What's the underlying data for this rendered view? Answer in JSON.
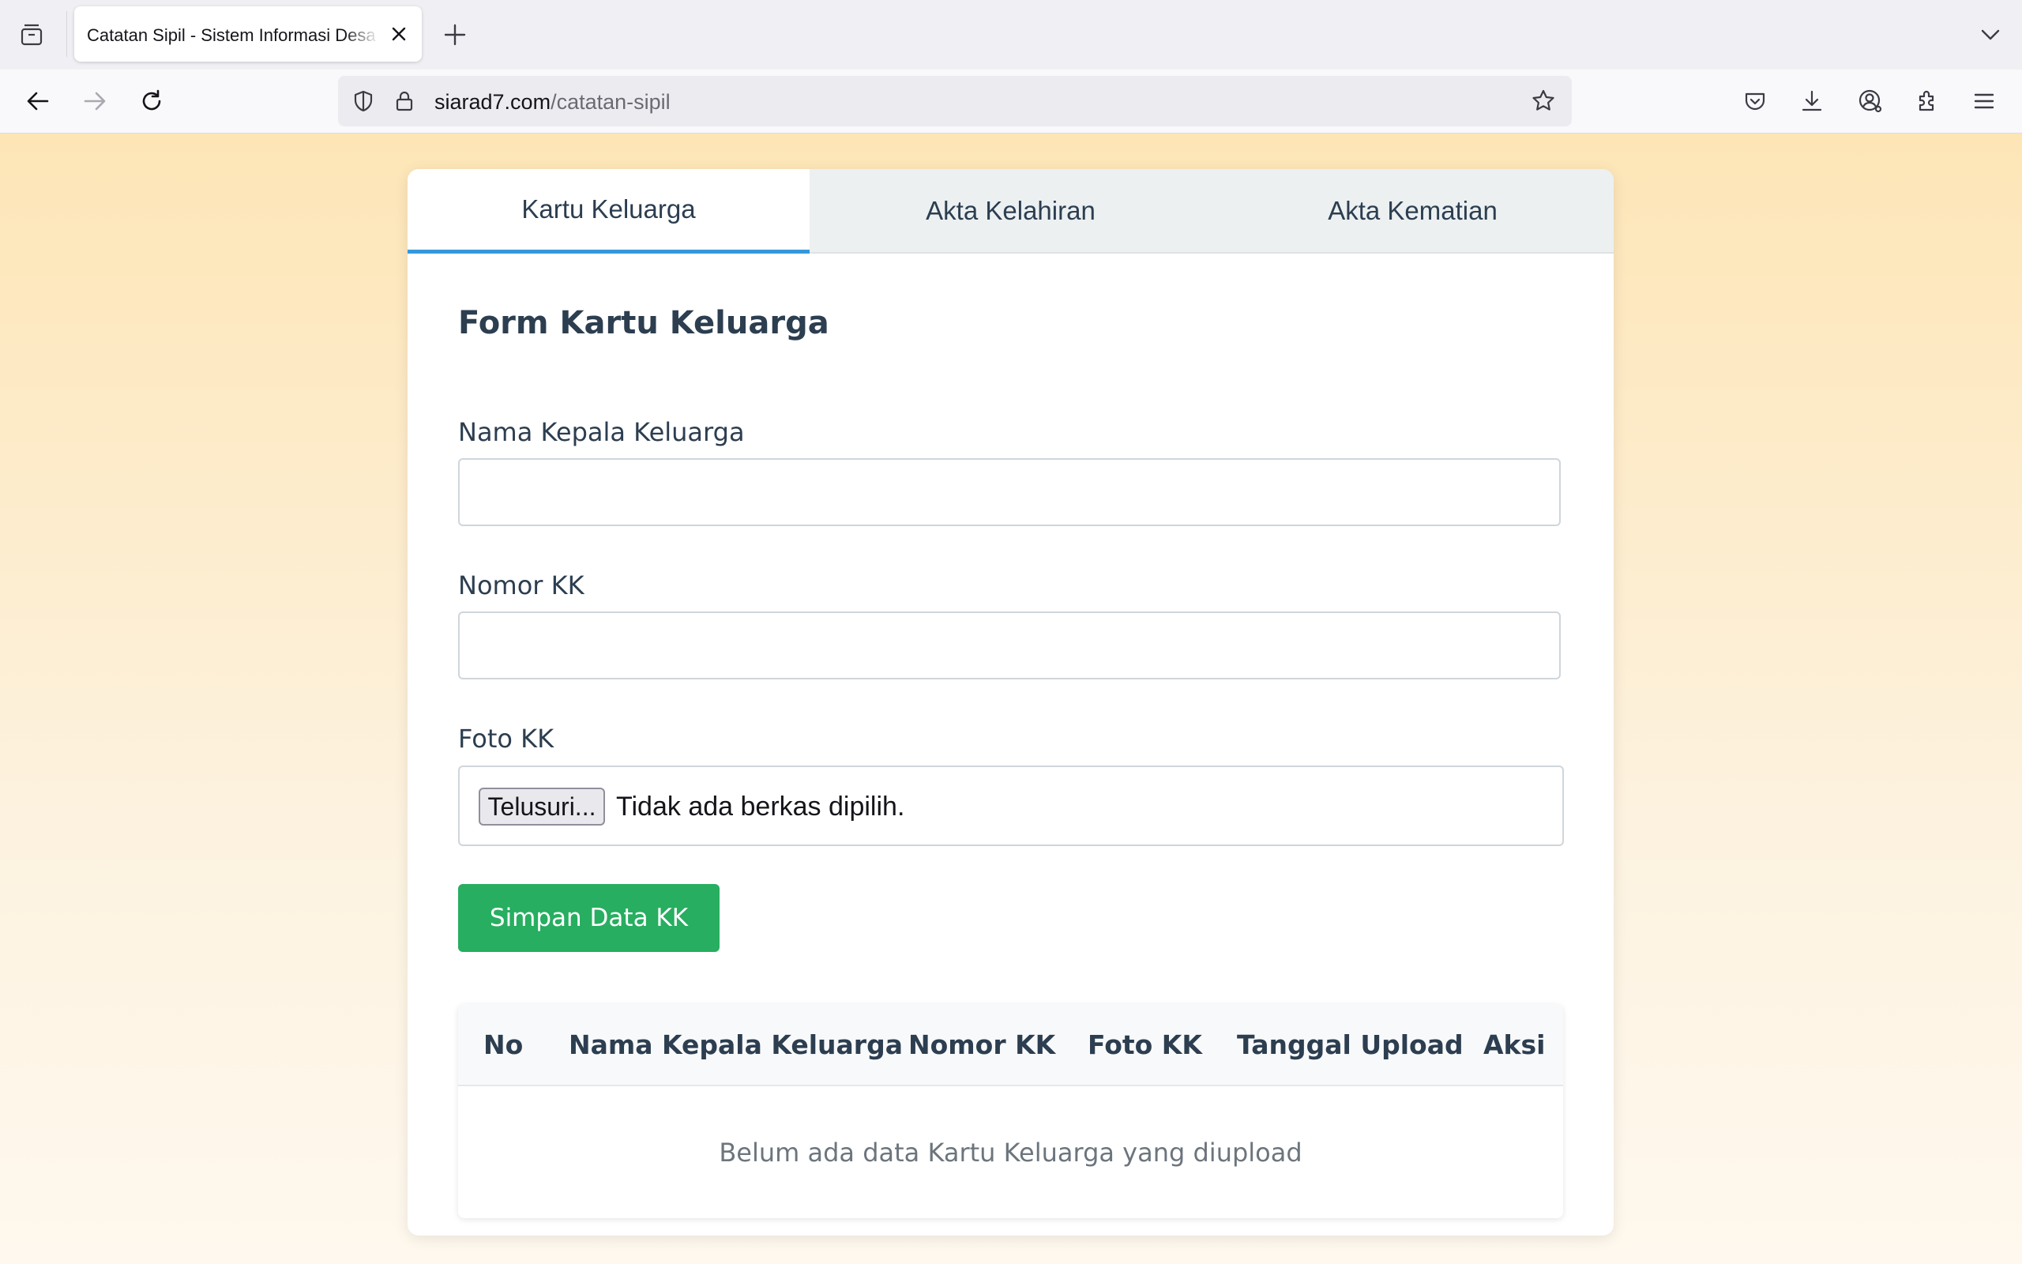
{
  "browser": {
    "tab_title": "Catatan Sipil - Sistem Informasi Desa",
    "url_host": "siarad7.com",
    "url_path": "/catatan-sipil"
  },
  "icons": {
    "tab_overview": "tab-overview-icon",
    "close_tab": "close-icon",
    "new_tab": "plus-icon",
    "list_all_tabs": "chevron-down-icon",
    "back": "back-arrow-icon",
    "forward": "forward-arrow-icon",
    "reload": "reload-icon",
    "tracking_protection": "shield-icon",
    "secure": "lock-icon",
    "bookmark": "star-icon",
    "pocket": "pocket-icon",
    "downloads": "download-icon",
    "account": "account-icon",
    "extensions": "extensions-icon",
    "menu": "hamburger-menu-icon"
  },
  "page": {
    "tabs": [
      {
        "label": "Kartu Keluarga",
        "active": true
      },
      {
        "label": "Akta Kelahiran",
        "active": false
      },
      {
        "label": "Akta Kematian",
        "active": false
      }
    ],
    "form": {
      "title": "Form Kartu Keluarga",
      "fields": {
        "nama_label": "Nama Kepala Keluarga",
        "nama_value": "",
        "nomor_label": "Nomor KK",
        "nomor_value": "",
        "foto_label": "Foto KK",
        "file_button": "Telusuri...",
        "file_status": "Tidak ada berkas dipilih."
      },
      "submit_label": "Simpan Data KK"
    },
    "table": {
      "columns": [
        "No",
        "Nama Kepala Keluarga",
        "Nomor KK",
        "Foto KK",
        "Tanggal Upload",
        "Aksi"
      ],
      "empty_message": "Belum ada data Kartu Keluarga yang diupload"
    }
  },
  "colors": {
    "accent_tab": "#3498db",
    "primary_button": "#27ae60",
    "heading": "#2c3e50",
    "background_top": "#fde5b6"
  }
}
